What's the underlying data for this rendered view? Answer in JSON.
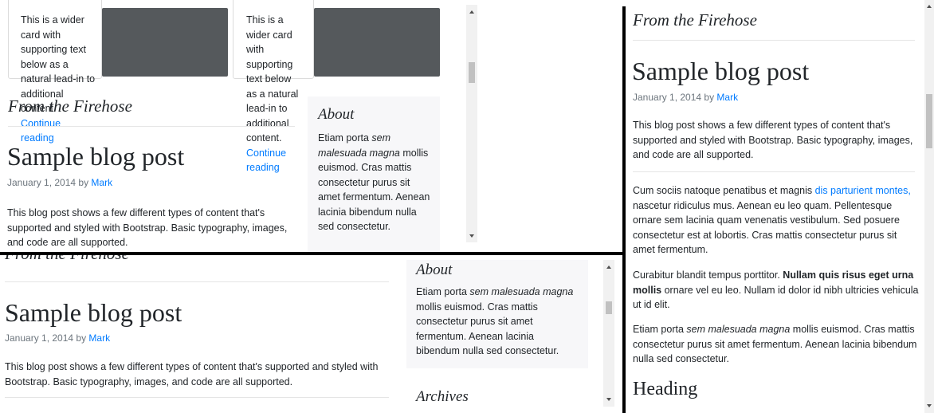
{
  "card_text": "This is a wider card with supporting text below as a natural lead-in to additional content.",
  "continue_reading": "Continue reading",
  "section_heading": "From the Firehose",
  "post": {
    "title": "Sample blog post",
    "date": "January 1, 2014 by",
    "author": "Mark",
    "intro": "This blog post shows a few different types of content that's supported and styled with Bootstrap. Basic typography, images, and code are all supported.",
    "p1_before": "Cum sociis natoque penatibus et magnis ",
    "p1_link": "dis parturient montes,",
    "p1_after": " nascetur ridiculus mus. Aenean eu leo quam. Pellentesque ornare sem lacinia quam venenatis vestibulum. Sed posuere consectetur est at lobortis. Cras mattis consectetur purus sit amet fermentum.",
    "p2_before": "Curabitur blandit tempus porttitor. ",
    "p2_bold": "Nullam quis risus eget urna mollis",
    "p2_after": " ornare vel eu leo. Nullam id dolor id nibh ultricies vehicula ut id elit.",
    "p3_before": "Etiam porta ",
    "p3_em": "sem malesuada magna",
    "p3_after": " mollis euismod. Cras mattis consectetur purus sit amet fermentum. Aenean lacinia bibendum nulla sed consectetur.",
    "heading": "Heading"
  },
  "about": {
    "title": "About",
    "text_before": "Etiam porta ",
    "text_em": "sem malesuada magna",
    "text_after": " mollis euismod. Cras mattis consectetur purus sit amet fermentum. Aenean lacinia bibendum nulla sed consectetur."
  },
  "archives": {
    "title": "Archives"
  },
  "colors": {
    "link": "#007bff",
    "muted": "#6c757d",
    "sidebar_bg": "#f7f7f9",
    "card_image": "#55595c"
  }
}
